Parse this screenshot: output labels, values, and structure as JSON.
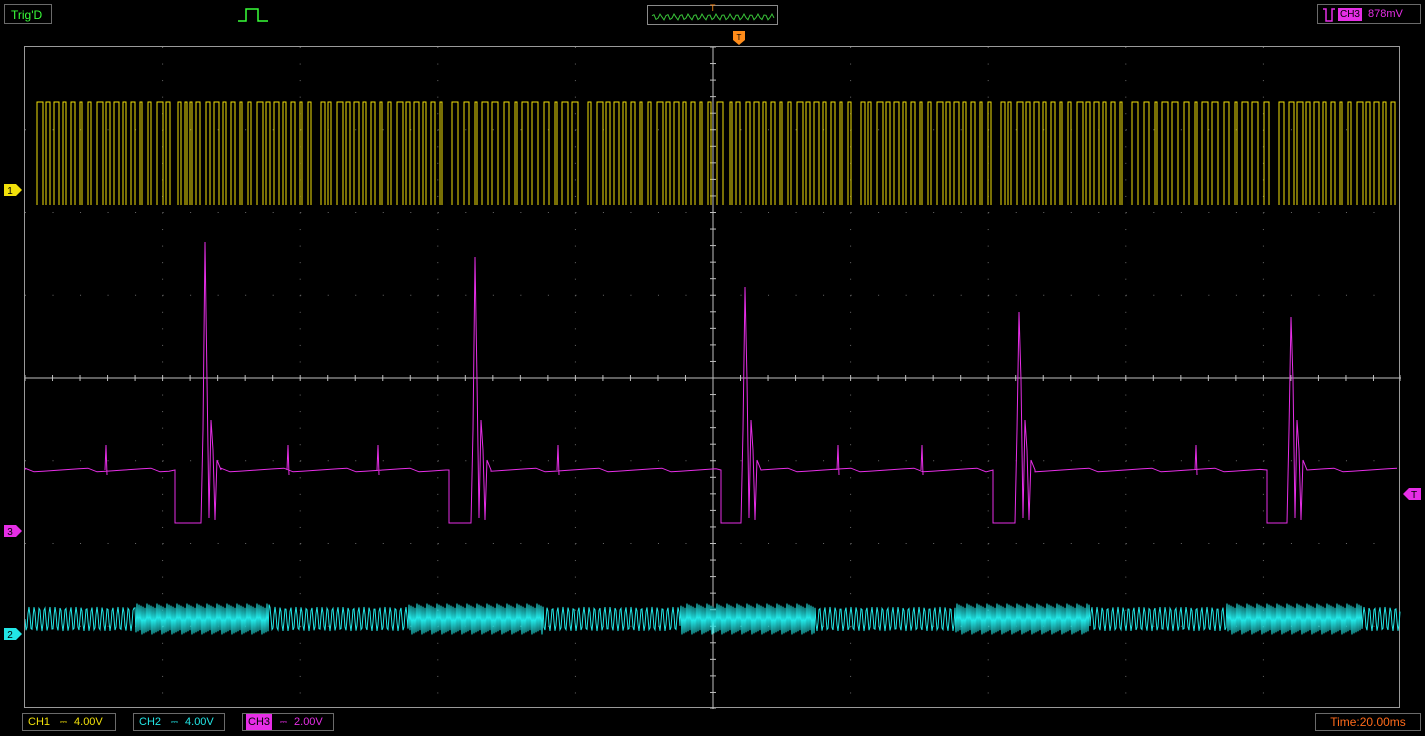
{
  "status": {
    "trigger_state": "Trig'D"
  },
  "trigger": {
    "source_label": "CH3",
    "level": "878mV",
    "position_marker_label": "T"
  },
  "channels": {
    "ch1": {
      "label": "CH1",
      "coupling_icon": "dc-coupling-icon",
      "scale": "4.00V",
      "color": "#f2e10a",
      "marker": "1"
    },
    "ch2": {
      "label": "CH2",
      "coupling_icon": "dc-coupling-icon",
      "scale": "4.00V",
      "color": "#22e6e6",
      "marker": "2"
    },
    "ch3": {
      "label": "CH3",
      "coupling_icon": "dc-coupling-icon",
      "scale": "2.00V",
      "color": "#e62ee6",
      "marker": "3"
    }
  },
  "timebase": {
    "label": "Time:20.00ms"
  },
  "trigger_level_marker": "T",
  "colors": {
    "trigger_marker": "#ff8c1a",
    "grid": "#7a7a7a",
    "time": "#ff6a1a"
  }
}
